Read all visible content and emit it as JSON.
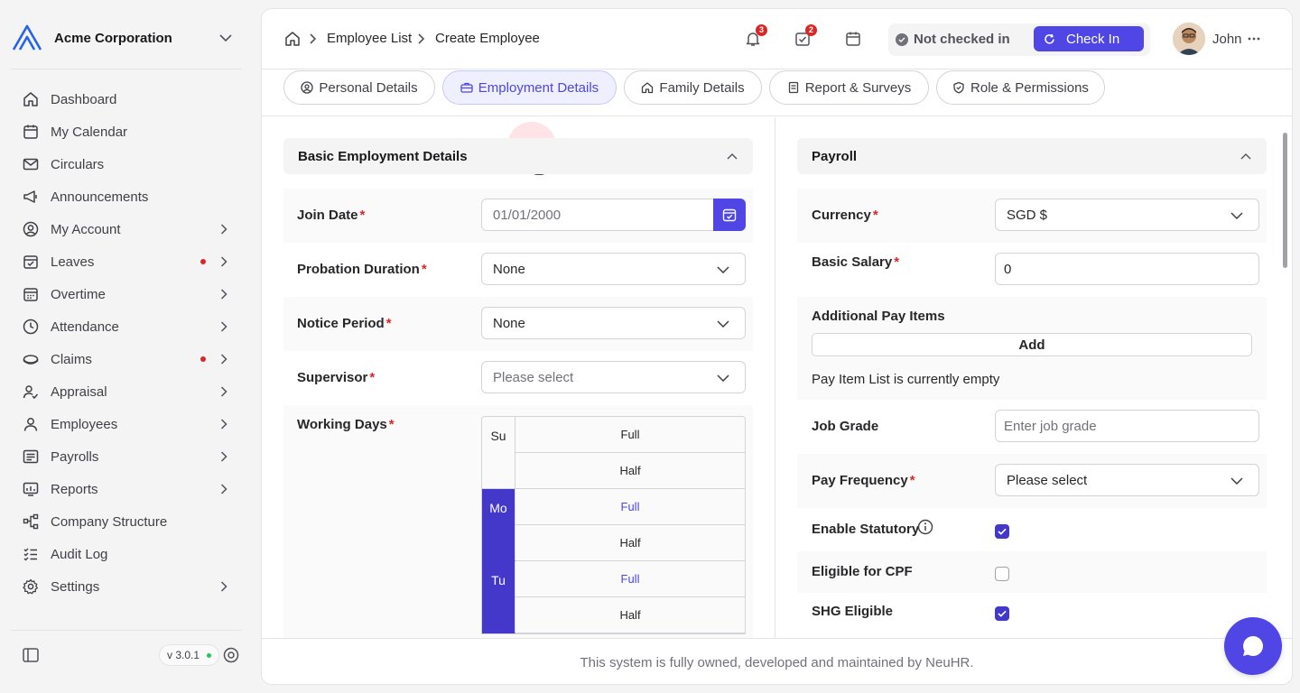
{
  "sidebar": {
    "company": "Acme Corporation",
    "items": [
      {
        "label": "Dashboard",
        "icon": "home-icon",
        "chevron": false,
        "dot": false
      },
      {
        "label": "My Calendar",
        "icon": "calendar-icon",
        "chevron": false,
        "dot": false
      },
      {
        "label": "Circulars",
        "icon": "mail-icon",
        "chevron": false,
        "dot": false
      },
      {
        "label": "Announcements",
        "icon": "megaphone-icon",
        "chevron": false,
        "dot": false
      },
      {
        "label": "My Account",
        "icon": "user-circle-icon",
        "chevron": true,
        "dot": false
      },
      {
        "label": "Leaves",
        "icon": "calendar-check-icon",
        "chevron": true,
        "dot": true
      },
      {
        "label": "Overtime",
        "icon": "calendar-grid-icon",
        "chevron": true,
        "dot": false
      },
      {
        "label": "Attendance",
        "icon": "clock-icon",
        "chevron": true,
        "dot": false
      },
      {
        "label": "Claims",
        "icon": "coins-icon",
        "chevron": true,
        "dot": true
      },
      {
        "label": "Appraisal",
        "icon": "user-star-icon",
        "chevron": true,
        "dot": false
      },
      {
        "label": "Employees",
        "icon": "user-icon",
        "chevron": true,
        "dot": false
      },
      {
        "label": "Payrolls",
        "icon": "receipt-icon",
        "chevron": true,
        "dot": false
      },
      {
        "label": "Reports",
        "icon": "chart-icon",
        "chevron": true,
        "dot": false
      },
      {
        "label": "Company Structure",
        "icon": "hierarchy-icon",
        "chevron": false,
        "dot": false
      },
      {
        "label": "Audit Log",
        "icon": "list-check-icon",
        "chevron": false,
        "dot": false
      },
      {
        "label": "Settings",
        "icon": "gear-icon",
        "chevron": true,
        "dot": false
      }
    ],
    "version": "v 3.0.1"
  },
  "header": {
    "breadcrumb": [
      "Employee List",
      "Create Employee"
    ],
    "notifications_count": "3",
    "tasks_count": "2",
    "check_status": "Not checked in",
    "check_in_label": "Check In",
    "user_name": "John"
  },
  "tabs": [
    {
      "label": "Personal Details",
      "icon": "user-circle-icon",
      "active": false
    },
    {
      "label": "Employment Details",
      "icon": "briefcase-icon",
      "active": true
    },
    {
      "label": "Family Details",
      "icon": "house-icon",
      "active": false
    },
    {
      "label": "Report & Surveys",
      "icon": "document-icon",
      "active": false
    },
    {
      "label": "Role & Permissions",
      "icon": "shield-icon",
      "active": false
    }
  ],
  "basic": {
    "title": "Basic Employment Details",
    "join_date_label": "Join Date",
    "join_date_value": "01/01/2000",
    "probation_label": "Probation Duration",
    "probation_value": "None",
    "notice_label": "Notice Period",
    "notice_value": "None",
    "supervisor_label": "Supervisor",
    "supervisor_placeholder": "Please select",
    "working_days_label": "Working Days",
    "required_mark": "*",
    "working_days": [
      {
        "day": "Su",
        "selected": false,
        "options": [
          {
            "label": "Full",
            "selected": false
          },
          {
            "label": "Half",
            "selected": false
          }
        ]
      },
      {
        "day": "Mo",
        "selected": true,
        "options": [
          {
            "label": "Full",
            "selected": true
          },
          {
            "label": "Half",
            "selected": false
          }
        ]
      },
      {
        "day": "Tu",
        "selected": true,
        "options": [
          {
            "label": "Full",
            "selected": true
          },
          {
            "label": "Half",
            "selected": false
          }
        ]
      }
    ]
  },
  "payroll": {
    "title": "Payroll",
    "currency_label": "Currency",
    "currency_value": "SGD $",
    "salary_label": "Basic Salary",
    "salary_value": "0",
    "additional_label": "Additional Pay Items",
    "add_label": "Add",
    "empty_text": "Pay Item List is currently empty",
    "job_grade_label": "Job Grade",
    "job_grade_placeholder": "Enter job grade",
    "pay_freq_label": "Pay Frequency",
    "pay_freq_placeholder": "Please select",
    "enable_statutory_label": "Enable Statutory",
    "enable_statutory": true,
    "cpf_label": "Eligible for CPF",
    "cpf": false,
    "shg_label": "SHG Eligible",
    "shg": true
  },
  "footer": "This system is fully owned, developed and maintained by NeuHR.",
  "colors": {
    "accent": "#4f46e5",
    "accent_dark": "#4338ca",
    "danger": "#dc2626"
  }
}
